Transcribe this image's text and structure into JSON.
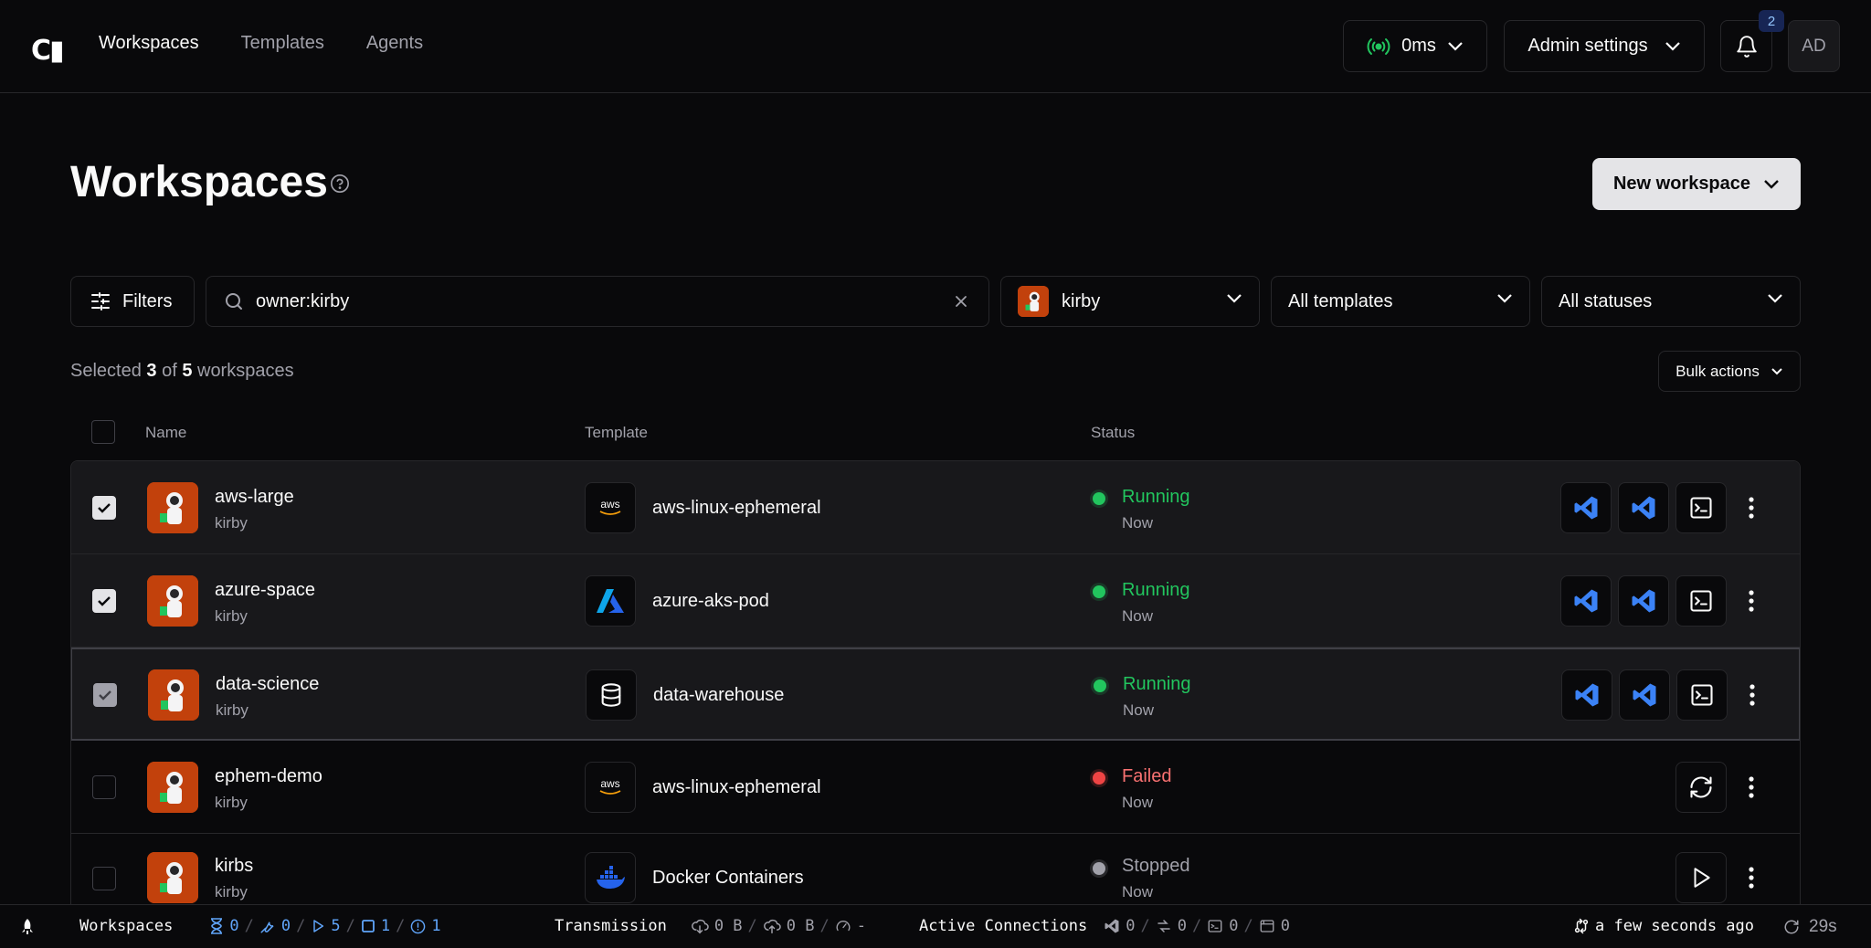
{
  "nav": {
    "logo": "C▮",
    "items": [
      {
        "label": "Workspaces",
        "active": true
      },
      {
        "label": "Templates",
        "active": false
      },
      {
        "label": "Agents",
        "active": false
      }
    ],
    "latency": "0ms",
    "admin_settings": "Admin settings",
    "notification_count": "2",
    "user_initials": "AD"
  },
  "page": {
    "title": "Workspaces",
    "new_workspace": "New workspace"
  },
  "filters": {
    "filters_label": "Filters",
    "search_value": "owner:kirby",
    "owner": "kirby",
    "templates": "All templates",
    "statuses": "All statuses"
  },
  "selection": {
    "prefix": "Selected ",
    "selected": "3",
    "middle": " of ",
    "total": "5",
    "suffix": " workspaces",
    "bulk_actions": "Bulk actions"
  },
  "table": {
    "headers": {
      "name": "Name",
      "template": "Template",
      "status": "Status"
    },
    "rows": [
      {
        "name": "aws-large",
        "owner": "kirby",
        "template": "aws-linux-ephemeral",
        "template_icon": "aws-icon",
        "status": "Running",
        "time": "Now",
        "checked": true
      },
      {
        "name": "azure-space",
        "owner": "kirby",
        "template": "azure-aks-pod",
        "template_icon": "azure-icon",
        "status": "Running",
        "time": "Now",
        "checked": true
      },
      {
        "name": "data-science",
        "owner": "kirby",
        "template": "data-warehouse",
        "template_icon": "database-icon",
        "status": "Running",
        "time": "Now",
        "checked": true
      },
      {
        "name": "ephem-demo",
        "owner": "kirby",
        "template": "aws-linux-ephemeral",
        "template_icon": "aws-icon",
        "status": "Failed",
        "time": "Now",
        "checked": false
      },
      {
        "name": "kirbs",
        "owner": "kirby",
        "template": "Docker Containers",
        "template_icon": "docker-icon",
        "status": "Stopped",
        "time": "Now",
        "checked": false
      }
    ],
    "aws_label": "aws"
  },
  "colors": {
    "running": "#22c55e",
    "failed": "#f87171",
    "failed_dot": "#ef4444",
    "stopped": "#a1a1aa",
    "vscode": "#3b82f6"
  },
  "bottombar": {
    "workspaces": "Workspaces",
    "pending": "0",
    "starting": "0",
    "running": "5",
    "stopped": "1",
    "failed": "1",
    "transmission": "Transmission",
    "rx": "0 B",
    "tx": "0 B",
    "latency": "-",
    "active_connections": "Active Connections",
    "vscode_conn": "0",
    "ssh_conn": "0",
    "terminal_conn": "0",
    "app_conn": "0",
    "last_update": "a few seconds ago",
    "refresh": "29s"
  }
}
